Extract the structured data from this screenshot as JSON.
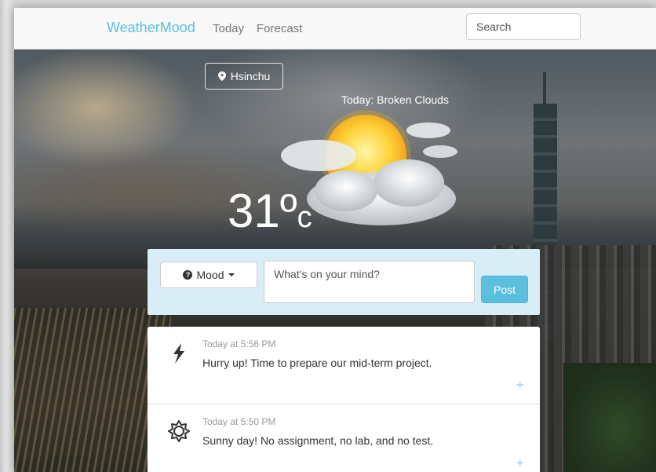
{
  "navbar": {
    "brand": "WeatherMood",
    "links": [
      "Today",
      "Forecast"
    ],
    "search_placeholder": "Search"
  },
  "hero": {
    "location": "Hsinchu",
    "condition": "Today: Broken Clouds",
    "temperature": "31",
    "degree_symbol": "º",
    "unit": "c",
    "weather_icon": "sun-behind-cloud-icon"
  },
  "post": {
    "mood_label": "Mood",
    "placeholder": "What's on your mind?",
    "post_label": "Post"
  },
  "feed": [
    {
      "icon": "lightning-icon",
      "time": "Today at 5:56 PM",
      "text": "Hurry up! Time to prepare our mid-term project.",
      "action": "+"
    },
    {
      "icon": "sun-outline-icon",
      "time": "Today at 5:50 PM",
      "text": "Sunny day! No assignment, no lab, and no test.",
      "action": "+"
    }
  ],
  "colors": {
    "brand": "#5bc0de",
    "post_panel": "#d9edf7",
    "post_button": "#5bc0de"
  }
}
